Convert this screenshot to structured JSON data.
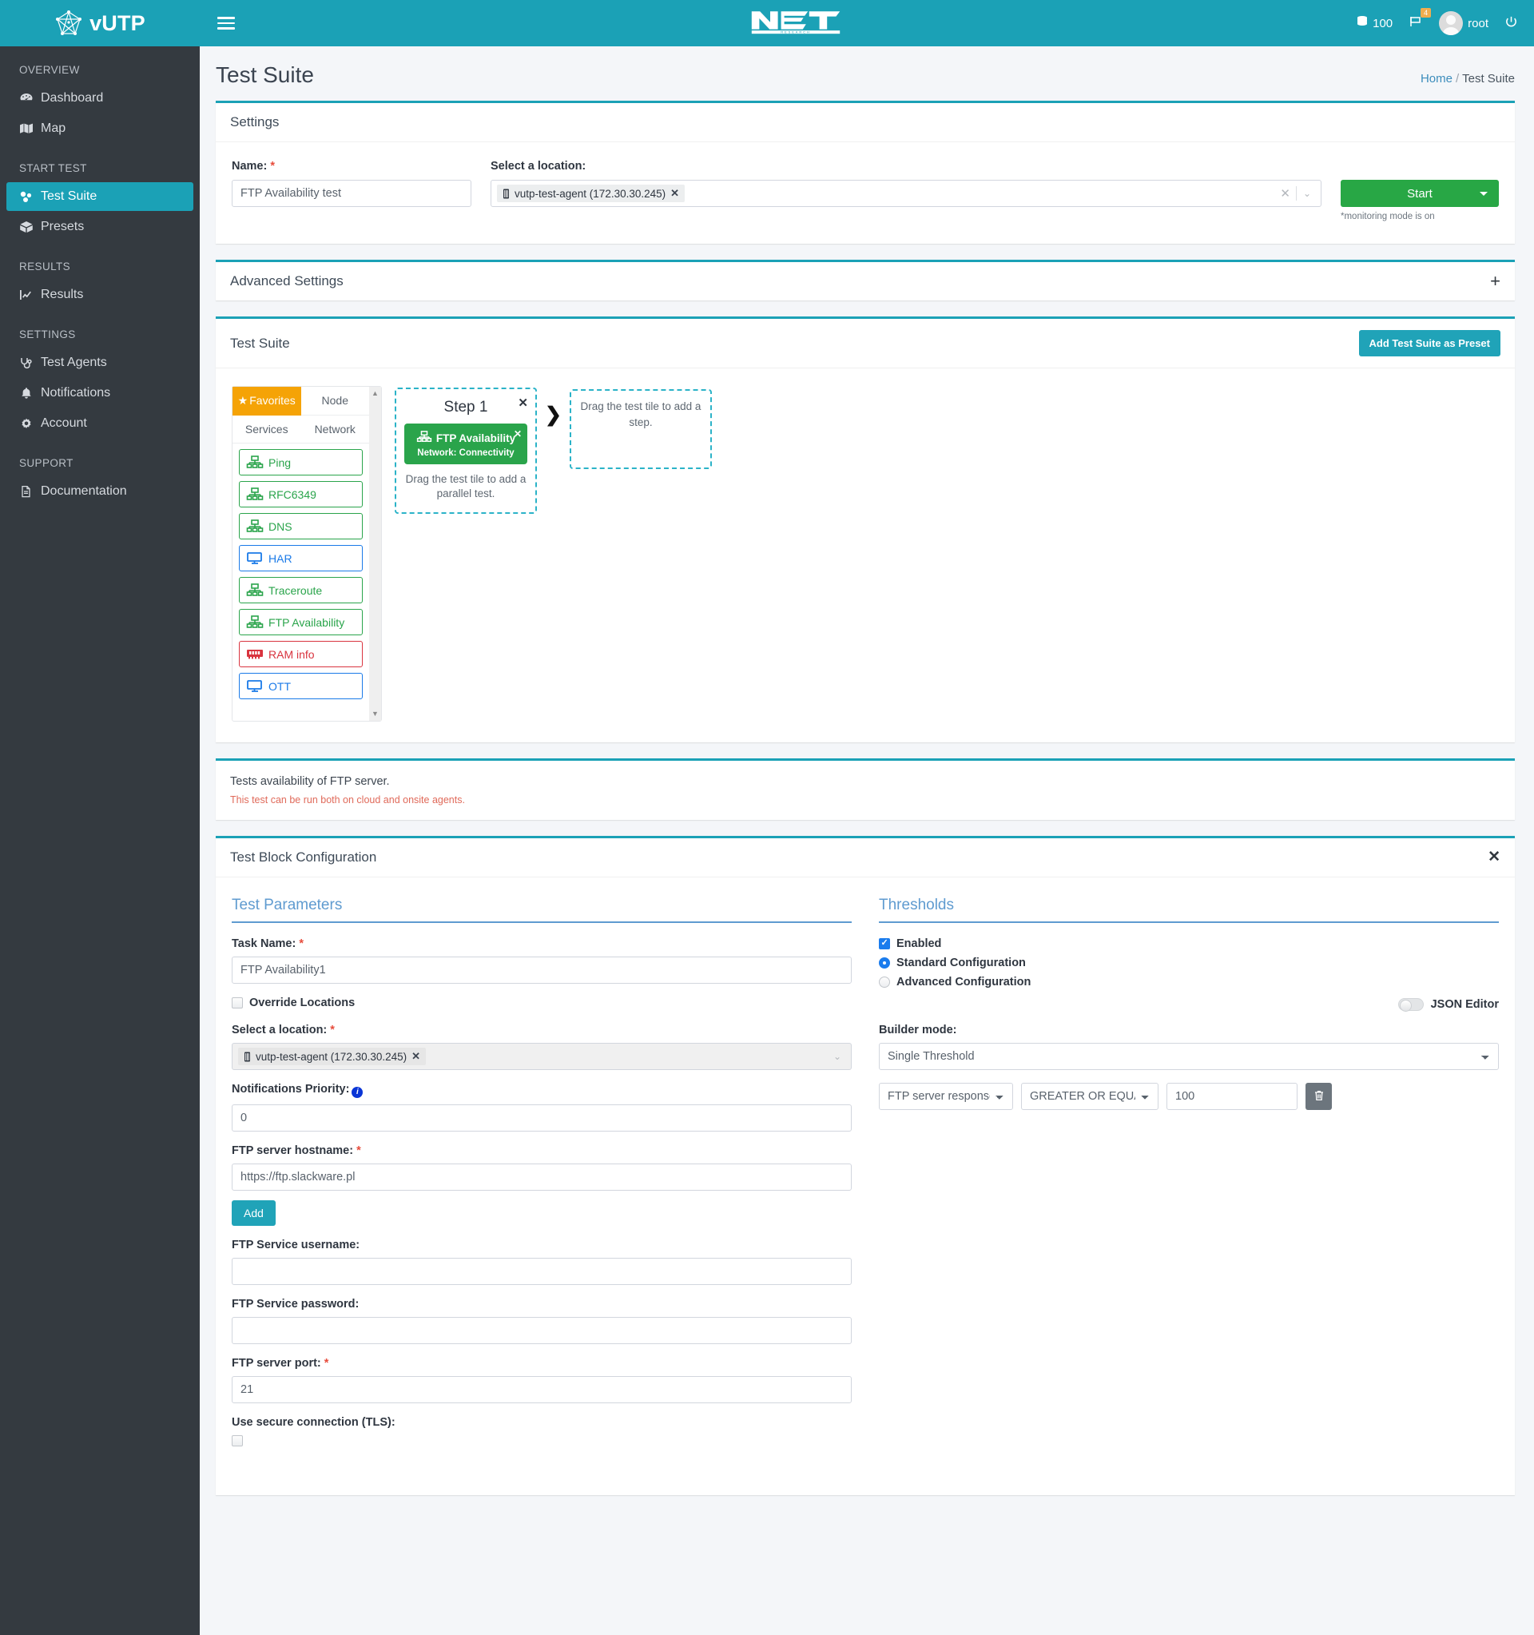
{
  "brand": {
    "name": "vUTP",
    "logo_icon": "network-nodes-logo"
  },
  "sidebar": {
    "sections": [
      {
        "label": "OVERVIEW",
        "items": [
          {
            "label": "Dashboard",
            "icon": "dashboard-icon",
            "active": false
          },
          {
            "label": "Map",
            "icon": "map-icon",
            "active": false
          }
        ]
      },
      {
        "label": "START TEST",
        "items": [
          {
            "label": "Test Suite",
            "icon": "test-suite-icon",
            "active": true
          },
          {
            "label": "Presets",
            "icon": "box-icon",
            "active": false
          }
        ]
      },
      {
        "label": "RESULTS",
        "items": [
          {
            "label": "Results",
            "icon": "chart-line-icon",
            "active": false
          }
        ]
      },
      {
        "label": "SETTINGS",
        "items": [
          {
            "label": "Test Agents",
            "icon": "stethoscope-icon",
            "active": false
          },
          {
            "label": "Notifications",
            "icon": "bell-icon",
            "active": false
          },
          {
            "label": "Account",
            "icon": "gear-icon",
            "active": false
          }
        ]
      },
      {
        "label": "SUPPORT",
        "items": [
          {
            "label": "Documentation",
            "icon": "document-icon",
            "active": false
          }
        ]
      }
    ]
  },
  "topbar": {
    "menu_icon": "hamburger-icon",
    "logo_text": "NET",
    "logo_subtext": "R E S E A R C H",
    "credits_icon": "database-icon",
    "credits": "100",
    "flag_icon": "flag-icon",
    "flag_badge": "4",
    "username": "root",
    "power_icon": "power-icon"
  },
  "page": {
    "title": "Test Suite",
    "breadcrumb_home": "Home",
    "breadcrumb_sep": "/",
    "breadcrumb_current": "Test Suite"
  },
  "settings_card": {
    "title": "Settings",
    "name_label": "Name:",
    "name_value": "FTP Availability test",
    "location_label": "Select a location:",
    "location_chip": "vutp-test-agent (172.30.30.245)",
    "chip_remove_icon": "chip-remove-icon",
    "clear_icon": "clear-icon",
    "caret_icon": "chevron-down-icon",
    "start_label": "Start",
    "start_caret_icon": "caret-down-icon",
    "monitoring_note": "*monitoring mode is on"
  },
  "advanced_settings": {
    "title": "Advanced Settings",
    "expand_icon": "plus-icon"
  },
  "test_suite_card": {
    "title": "Test Suite",
    "preset_button": "Add Test Suite as Preset",
    "tabs": [
      {
        "label": "Favorites",
        "active": true,
        "icon": "star-icon"
      },
      {
        "label": "Node",
        "active": false
      },
      {
        "label": "Services",
        "active": false
      },
      {
        "label": "Network",
        "active": false
      }
    ],
    "tiles": [
      {
        "label": "Ping",
        "color": "green",
        "icon": "network-icon"
      },
      {
        "label": "RFC6349",
        "color": "green",
        "icon": "network-icon"
      },
      {
        "label": "DNS",
        "color": "green",
        "icon": "network-icon"
      },
      {
        "label": "HAR",
        "color": "blue",
        "icon": "monitor-icon"
      },
      {
        "label": "Traceroute",
        "color": "green",
        "icon": "network-icon"
      },
      {
        "label": "FTP Availability",
        "color": "green",
        "icon": "network-icon"
      },
      {
        "label": "RAM info",
        "color": "red",
        "icon": "ram-icon"
      },
      {
        "label": "OTT",
        "color": "blue",
        "icon": "monitor-icon"
      }
    ],
    "scroll_up_icon": "scroll-up-icon",
    "scroll_down_icon": "scroll-down-icon",
    "step": {
      "title": "Step 1",
      "remove_icon": "close-icon",
      "tile_name": "FTP Availability",
      "tile_category": "Network: Connectivity",
      "tile_icon": "network-icon",
      "tile_remove_icon": "close-icon",
      "hint": "Drag the test tile to add a parallel test."
    },
    "arrow_icon": "chevron-right-icon",
    "dropzone_hint": "Drag the test tile to add a step."
  },
  "description_card": {
    "line1": "Tests availability of FTP server.",
    "line2": "This test can be run both on cloud and onsite agents."
  },
  "test_block_config": {
    "title": "Test Block Configuration",
    "close_icon": "close-icon",
    "parameters": {
      "section_title": "Test Parameters",
      "task_name_label": "Task Name:",
      "task_name_value": "FTP Availability1",
      "override_locations_label": "Override Locations",
      "override_locations_checked": false,
      "location_label": "Select a location:",
      "location_chip": "vutp-test-agent (172.30.30.245)",
      "chip_remove_icon": "chip-remove-icon",
      "caret_icon": "chevron-down-icon",
      "notifications_priority_label": "Notifications Priority:",
      "notifications_priority_info_icon": "info-icon",
      "notifications_priority_value": "0",
      "hostname_label": "FTP server hostname:",
      "hostname_value": "https://ftp.slackware.pl",
      "add_button": "Add",
      "username_label": "FTP Service username:",
      "username_value": "",
      "password_label": "FTP Service password:",
      "password_value": "",
      "port_label": "FTP server port:",
      "port_value": "21",
      "tls_label": "Use secure connection (TLS):",
      "tls_checked": false
    },
    "thresholds": {
      "section_title": "Thresholds",
      "enabled_label": "Enabled",
      "enabled_checked": true,
      "standard_label": "Standard Configuration",
      "standard_selected": true,
      "advanced_label": "Advanced Configuration",
      "advanced_selected": false,
      "json_editor_label": "JSON Editor",
      "json_editor_on": false,
      "builder_mode_label": "Builder mode:",
      "builder_mode_value": "Single Threshold",
      "rule_metric": "FTP server response time",
      "rule_operator": "GREATER OR EQUAL THAN",
      "rule_value": "100",
      "delete_icon": "trash-icon"
    }
  },
  "colors": {
    "brand_teal": "#1ba1b6",
    "sidebar_dark": "#343a40",
    "green": "#28a745",
    "tile_green": "#2aa44b",
    "orange": "#f5a306",
    "blue_accent": "#5f9bd0",
    "red": "#d9343f"
  }
}
